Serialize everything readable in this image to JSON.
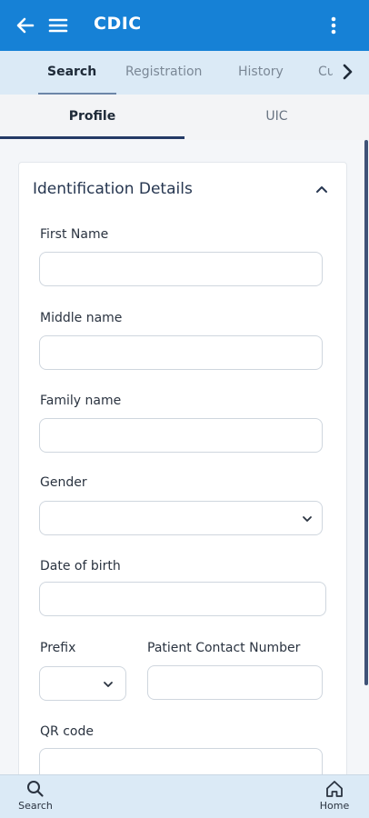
{
  "app": {
    "title": "CDIC"
  },
  "icons": {
    "back": "arrow-left-icon",
    "menu": "hamburger-menu-icon",
    "more": "kebab-menu-icon",
    "next": "chevron-right-icon",
    "collapse": "chevron-up-icon",
    "dropdown": "chevron-down-icon",
    "search": "search-icon",
    "home": "home-icon"
  },
  "colors": {
    "appbar": "#1681d6",
    "tabbar": "#dbeaf6",
    "accent": "#233a66"
  },
  "tabs": [
    {
      "label": "Search",
      "active": true
    },
    {
      "label": "Registration",
      "active": false
    },
    {
      "label": "History",
      "active": false
    },
    {
      "label": "Cu",
      "active": false
    }
  ],
  "subtabs": [
    {
      "label": "Profile",
      "active": true
    },
    {
      "label": "UIC",
      "active": false
    }
  ],
  "section": {
    "title": "Identification Details"
  },
  "form": {
    "first_name": {
      "label": "First Name",
      "value": ""
    },
    "middle_name": {
      "label": "Middle name",
      "value": ""
    },
    "family_name": {
      "label": "Family name",
      "value": ""
    },
    "gender": {
      "label": "Gender",
      "value": ""
    },
    "date_of_birth": {
      "label": "Date of birth",
      "value": ""
    },
    "prefix": {
      "label": "Prefix",
      "value": ""
    },
    "contact_number": {
      "label": "Patient Contact Number",
      "value": ""
    },
    "qr_code": {
      "label": "QR code",
      "value": ""
    }
  },
  "bottom_nav": [
    {
      "label": "Search"
    },
    {
      "label": "Home"
    }
  ]
}
